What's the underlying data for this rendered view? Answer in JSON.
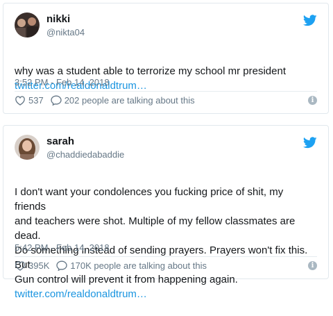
{
  "colors": {
    "link": "#1b95e0",
    "bird": "#1da1f2",
    "muted": "#657786"
  },
  "tweets": [
    {
      "name": "nikki",
      "handle": "@nikta04",
      "text": "why was a student able to terrorize my school mr president",
      "link": "twitter.com/realdonaldtrum…",
      "time": "3:52 PM - Feb 14, 2018",
      "likes": "537",
      "talking": "202 people are talking about this",
      "icons": [
        "twitter-bird-icon",
        "heart-icon",
        "comment-icon",
        "info-icon"
      ]
    },
    {
      "name": "sarah",
      "handle": "@chaddiedabaddie",
      "text": "I don't want your condolences you fucking price of shit, my friends\nand teachers were shot. Multiple of my fellow classmates are dead.\nDo something instead of sending prayers. Prayers won't fix this. But\nGun control will prevent it from happening again.",
      "link": "twitter.com/realdonaldtrum…",
      "time": "5:42 PM - Feb 14, 2018",
      "likes": "395K",
      "talking": "170K people are talking about this",
      "icons": [
        "twitter-bird-icon",
        "heart-icon",
        "comment-icon",
        "info-icon"
      ]
    }
  ]
}
